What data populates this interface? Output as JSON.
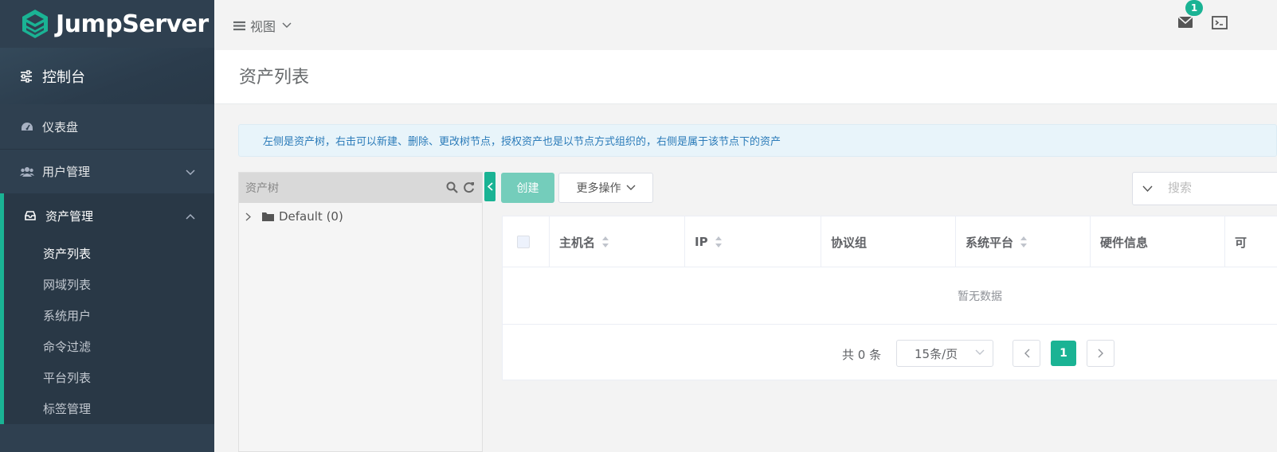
{
  "app": {
    "logo_text": "JumpServer"
  },
  "sidebar": {
    "console_label": "控制台",
    "items": [
      {
        "label": "仪表盘"
      },
      {
        "label": "用户管理"
      },
      {
        "label": "资产管理"
      }
    ],
    "submenu": [
      {
        "label": "资产列表"
      },
      {
        "label": "网域列表"
      },
      {
        "label": "系统用户"
      },
      {
        "label": "命令过滤"
      },
      {
        "label": "平台列表"
      },
      {
        "label": "标签管理"
      }
    ]
  },
  "topbar": {
    "view_label": "视图",
    "notification_count": "1"
  },
  "page": {
    "title": "资产列表",
    "info": "左侧是资产树，右击可以新建、删除、更改树节点，授权资产也是以节点方式组织的，右侧是属于该节点下的资产"
  },
  "tree": {
    "search_placeholder": "资产树",
    "root_node": "Default (0)"
  },
  "actions": {
    "create_label": "创建",
    "more_label": "更多操作"
  },
  "search": {
    "placeholder": "搜索"
  },
  "table": {
    "columns": [
      "主机名",
      "IP",
      "协议组",
      "系统平台",
      "硬件信息",
      "可"
    ],
    "empty_text": "暂无数据"
  },
  "pagination": {
    "total": "共 0 条",
    "page_size": "15条/页",
    "current_page": "1"
  },
  "colors": {
    "accent": "#1ab394",
    "sidebar_bg": "#2f4050"
  }
}
